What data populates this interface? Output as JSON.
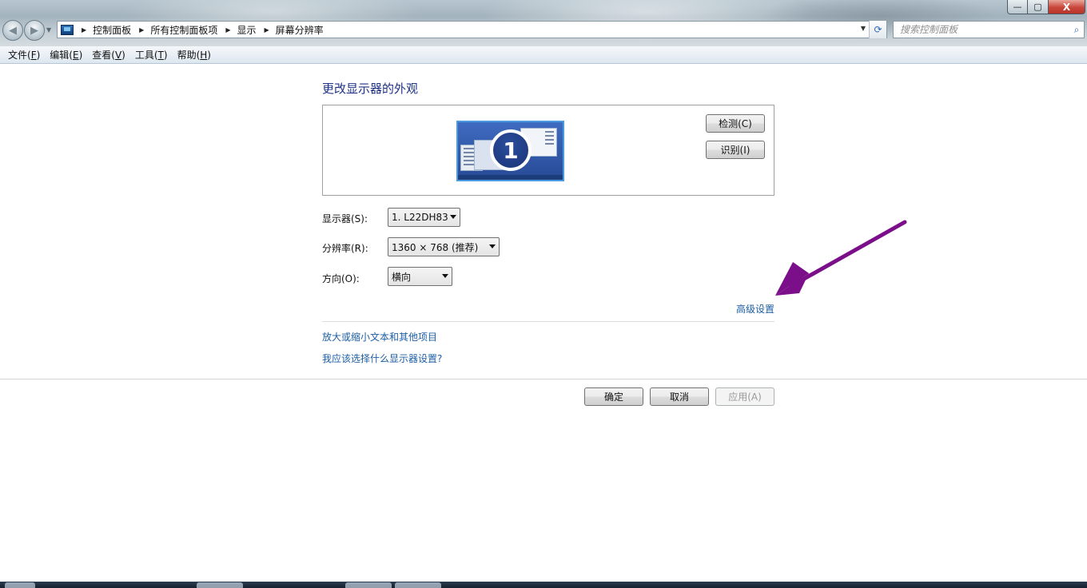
{
  "window": {
    "minimize": "—",
    "maximize": "▢",
    "close": "X"
  },
  "nav": {
    "back": "◀",
    "forward": "▶",
    "history_dropdown": "▼"
  },
  "address": {
    "crumbs": [
      "控制面板",
      "所有控制面板项",
      "显示",
      "屏幕分辨率"
    ],
    "separator": "▶",
    "dropdown": "▼",
    "refresh": "⟳"
  },
  "search": {
    "placeholder": "搜索控制面板",
    "icon": "⌕"
  },
  "menubar": [
    {
      "label": "文件(",
      "key": "F",
      "tail": ")"
    },
    {
      "label": "编辑(",
      "key": "E",
      "tail": ")"
    },
    {
      "label": "查看(",
      "key": "V",
      "tail": ")"
    },
    {
      "label": "工具(",
      "key": "T",
      "tail": ")"
    },
    {
      "label": "帮助(",
      "key": "H",
      "tail": ")"
    }
  ],
  "main": {
    "title": "更改显示器的外观",
    "monitor_number": "1",
    "detect_button": "检测(C)",
    "identify_button": "识别(I)",
    "display_label": "显示器(S):",
    "display_value": "1. L22DH83",
    "resolution_label": "分辨率(R):",
    "resolution_value": "1360 × 768 (推荐)",
    "orientation_label": "方向(O):",
    "orientation_value": "横向",
    "advanced_link": "高级设置",
    "link_text_size": "放大或缩小文本和其他项目",
    "link_which_settings": "我应该选择什么显示器设置?"
  },
  "footer": {
    "ok_button": "确定",
    "cancel_button": "取消",
    "apply_button": "应用(A)"
  },
  "colors": {
    "link": "#1d5fa5",
    "title": "#1e3287",
    "annotation_arrow": "#7b0f8a"
  }
}
